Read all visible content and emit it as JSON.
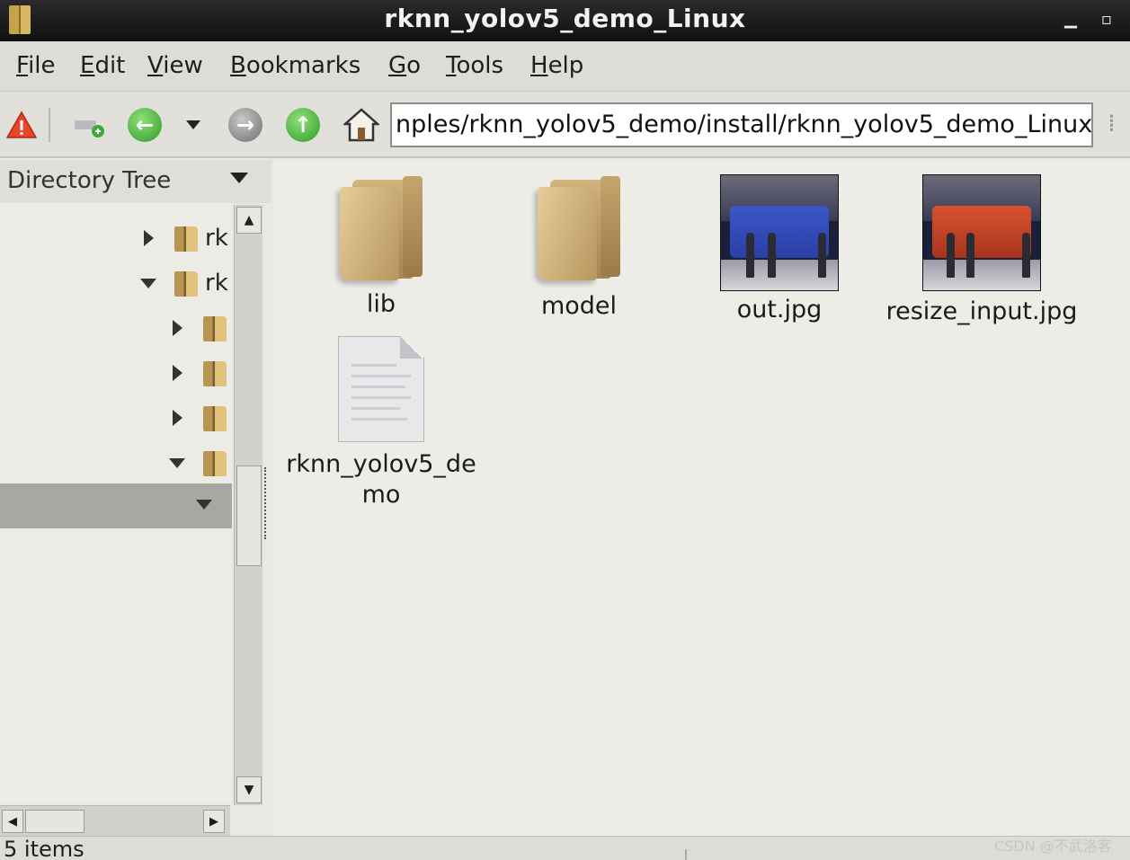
{
  "window": {
    "title": "rknn_yolov5_demo_Linux",
    "controls": {
      "minimize": "▁",
      "maximize": "▫"
    }
  },
  "menubar": {
    "items": [
      "File",
      "Edit",
      "View",
      "Bookmarks",
      "Go",
      "Tools",
      "Help"
    ]
  },
  "toolbar": {
    "location": "nples/rknn_yolov5_demo/install/rknn_yolov5_demo_Linux",
    "buttons": [
      "warning-icon",
      "new-tab-icon",
      "back-icon",
      "history-dropdown-icon",
      "forward-icon",
      "up-icon",
      "home-icon"
    ]
  },
  "sidebar": {
    "header": "Directory Tree",
    "rows": [
      {
        "label": "rk",
        "expanded": false,
        "level": 0
      },
      {
        "label": "rk",
        "expanded": true,
        "level": 0
      },
      {
        "label": "",
        "expanded": false,
        "level": 1
      },
      {
        "label": "",
        "expanded": false,
        "level": 1
      },
      {
        "label": "",
        "expanded": false,
        "level": 1
      },
      {
        "label": "",
        "expanded": true,
        "level": 1
      },
      {
        "label": "",
        "expanded": true,
        "level": 2,
        "selected": true
      }
    ]
  },
  "files": {
    "items": [
      {
        "name": "lib",
        "type": "folder"
      },
      {
        "name": "model",
        "type": "folder"
      },
      {
        "name": "out.jpg",
        "type": "image"
      },
      {
        "name": "resize_input.jpg",
        "type": "image"
      },
      {
        "name_line1": "rknn_yolov5_de",
        "name_line2": "mo",
        "type": "file"
      }
    ]
  },
  "status": {
    "count": "5 items"
  },
  "watermark": "CSDN @不武洛客",
  "colors": {
    "titlebar": "#1a1a1a",
    "folder": "#d3b47c",
    "background": "#edede8"
  }
}
